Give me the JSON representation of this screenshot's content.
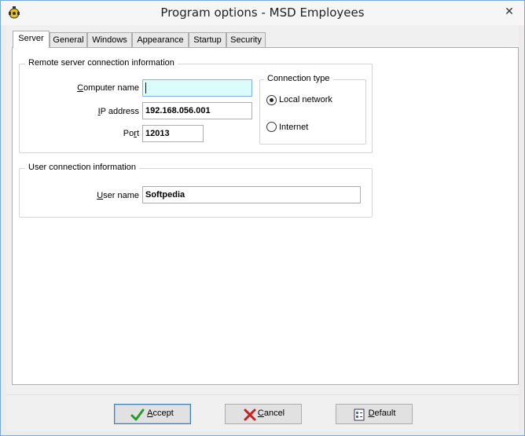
{
  "window": {
    "title": "Program options - MSD Employees",
    "close_glyph": "✕"
  },
  "tabs": [
    {
      "label": "Server",
      "active": true
    },
    {
      "label": "General"
    },
    {
      "label": "Windows"
    },
    {
      "label": "Appearance"
    },
    {
      "label": "Startup"
    },
    {
      "label": "Security"
    }
  ],
  "server": {
    "remote_group": {
      "legend": "Remote server connection information",
      "computer_name": {
        "label_u": "C",
        "label_rest": "omputer name",
        "value": ""
      },
      "ip_address": {
        "label_u": "I",
        "label_rest": "P address",
        "value": "192.168.056.001"
      },
      "port": {
        "label_pre": "Po",
        "label_u": "r",
        "label_rest": "t",
        "value": "12013"
      }
    },
    "connection_type": {
      "legend": "Connection type",
      "options": [
        {
          "label": "Local network",
          "selected": true
        },
        {
          "label": "Internet",
          "selected": false
        }
      ]
    },
    "user_group": {
      "legend": "User connection information",
      "user_name": {
        "label_u": "U",
        "label_rest": "ser name",
        "value": "Softpedia"
      }
    }
  },
  "buttons": {
    "accept": {
      "u": "A",
      "rest": "ccept",
      "icon": "checkmark-icon"
    },
    "cancel": {
      "u": "C",
      "rest": "ancel",
      "icon": "cross-icon"
    },
    "default": {
      "u": "D",
      "rest": "efault",
      "icon": "checklist-icon"
    }
  },
  "colors": {
    "focused_input_bg": "#dcfcfc",
    "accept_icon": "#2a9a2a",
    "cancel_icon": "#c62020"
  }
}
